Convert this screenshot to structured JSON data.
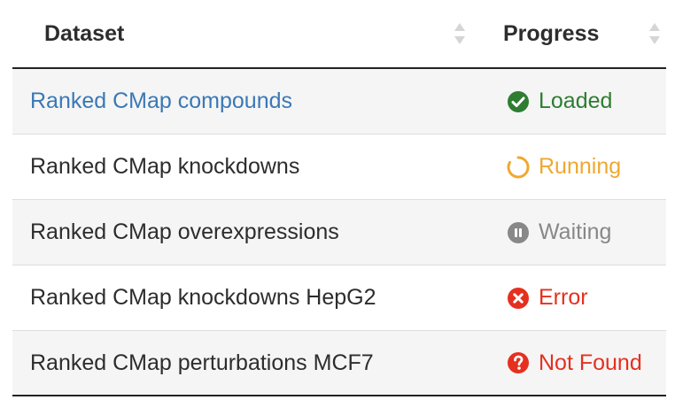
{
  "table": {
    "headers": {
      "dataset": "Dataset",
      "progress": "Progress"
    },
    "rows": [
      {
        "dataset": "Ranked CMap compounds",
        "is_link": true,
        "status": "Loaded",
        "status_icon": "check-circle-icon",
        "status_color": "#2e7d32"
      },
      {
        "dataset": "Ranked CMap knockdowns",
        "is_link": false,
        "status": "Running",
        "status_icon": "spinner-icon",
        "status_color": "#f0a830"
      },
      {
        "dataset": "Ranked CMap overexpressions",
        "is_link": false,
        "status": "Waiting",
        "status_icon": "pause-circle-icon",
        "status_color": "#888888"
      },
      {
        "dataset": "Ranked CMap knockdowns HepG2",
        "is_link": false,
        "status": "Error",
        "status_icon": "times-circle-icon",
        "status_color": "#e53020"
      },
      {
        "dataset": "Ranked CMap perturbations MCF7",
        "is_link": false,
        "status": "Not Found",
        "status_icon": "question-circle-icon",
        "status_color": "#e53020"
      }
    ]
  },
  "colors": {
    "link": "#3a78b5",
    "text": "#2d2d2d",
    "stripe": "#f5f5f5"
  }
}
